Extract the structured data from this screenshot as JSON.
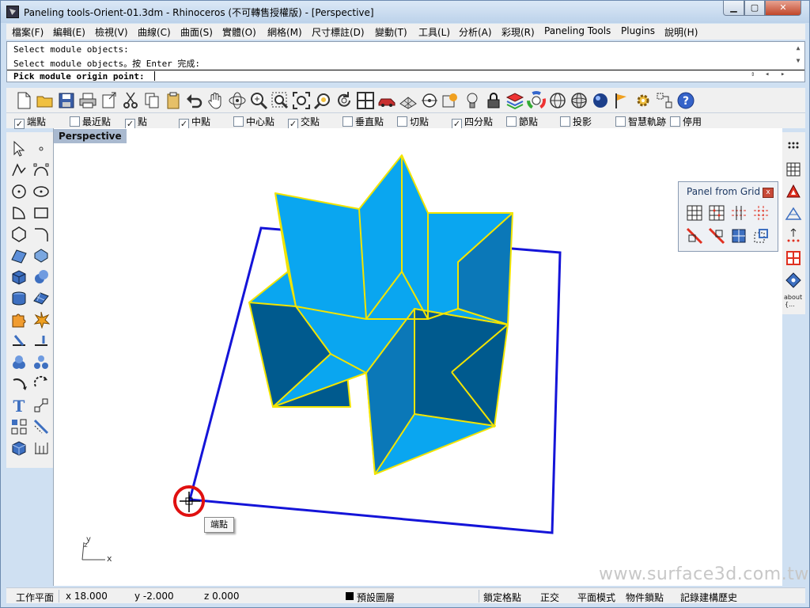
{
  "window": {
    "title": "Paneling tools-Orient-01.3dm - Rhinoceros (不可轉售授權版) - [Perspective]",
    "min_glyph": "▁",
    "max_glyph": "▢",
    "close_glyph": "✕"
  },
  "menu": [
    "檔案(F)",
    "編輯(E)",
    "檢視(V)",
    "曲線(C)",
    "曲面(S)",
    "實體(O)",
    "網格(M)",
    "尺寸標註(D)",
    "變動(T)",
    "工具(L)",
    "分析(A)",
    "彩現(R)",
    "Paneling Tools",
    "Plugins",
    "說明(H)"
  ],
  "command": {
    "history": [
      "Select module objects:",
      "Select module objects。按 Enter 完成:"
    ],
    "prompt": "Pick module origin point:"
  },
  "toolbar_icons": [
    "new-file-icon",
    "open-file-icon",
    "save-icon",
    "print-icon",
    "export-icon",
    "cut-icon",
    "copy-icon",
    "paste-icon",
    "undo-icon",
    "pan-hand-icon",
    "rotate-view-icon",
    "zoom-icon",
    "zoom-window-icon",
    "zoom-extents-icon",
    "zoom-selected-icon",
    "undo-view-icon",
    "four-viewports-icon",
    "car-icon",
    "grid-plane-icon",
    "target-icon",
    "material-icon",
    "light-bulb-icon",
    "lock-icon",
    "layer-icon",
    "color-wheel-icon",
    "globe-icon",
    "mesh-sphere-icon",
    "render-sphere-icon",
    "flag-icon",
    "gear-icon",
    "grid-snap-icon",
    "help-icon"
  ],
  "osnaps": [
    {
      "label": "端點",
      "checked": true
    },
    {
      "label": "最近點",
      "checked": false
    },
    {
      "label": "點",
      "checked": true
    },
    {
      "label": "中點",
      "checked": true
    },
    {
      "label": "中心點",
      "checked": false
    },
    {
      "label": "交點",
      "checked": true
    },
    {
      "label": "垂直點",
      "checked": false
    },
    {
      "label": "切點",
      "checked": false
    },
    {
      "label": "四分點",
      "checked": true
    },
    {
      "label": "節點",
      "checked": false
    },
    {
      "label": "投影",
      "checked": false
    },
    {
      "label": "智慧軌跡",
      "checked": false
    },
    {
      "label": "停用",
      "checked": false
    }
  ],
  "viewport": {
    "title": "Perspective",
    "axis_x": "x",
    "axis_y": "y",
    "axis_z": "z",
    "snap_tooltip": "端點",
    "watermark": "www.surface3d.com.tw"
  },
  "panel_from_grid": {
    "title": "Panel from Grid",
    "close_glyph": "x"
  },
  "right_tools": {
    "about_label": "about",
    "about_sub": "{..."
  },
  "status": {
    "cplane": "工作平面",
    "x": "x 18.000",
    "y": "y -2.000",
    "z": "z 0.000",
    "layer": "預設圖層",
    "grid_snap": "鎖定格點",
    "ortho": "正交",
    "planar": "平面模式",
    "osnap": "物件鎖點",
    "history": "記錄建構歷史"
  },
  "colors": {
    "face_light": "#0aa6f0",
    "face_dark": "#005a8e",
    "face_mid": "#0b78b8",
    "edge_selected": "#f2e400",
    "plane_outline": "#1414d8",
    "highlight_circle": "#e01010"
  }
}
